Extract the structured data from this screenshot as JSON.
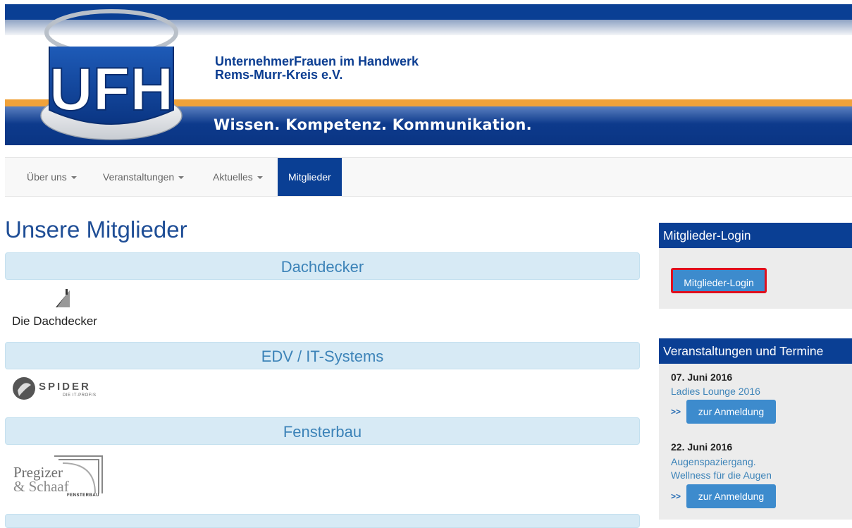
{
  "header": {
    "org_name": "UnternehmerFrauen im Handwerk\nRems-Murr-Kreis e.V.",
    "slogan": "Wissen. Kompetenz. Kommunikation.",
    "logo_text": "UFH"
  },
  "nav": {
    "items": [
      {
        "label": "Über uns",
        "dropdown": true
      },
      {
        "label": "Veranstaltungen",
        "dropdown": true
      },
      {
        "label": "Aktuelles",
        "dropdown": true
      },
      {
        "label": "Mitglieder",
        "dropdown": false,
        "active": true
      }
    ]
  },
  "main": {
    "title": "Unsere Mitglieder",
    "categories": [
      {
        "label": "Dachdecker",
        "logo_text": "Die Dachdecker"
      },
      {
        "label": "EDV / IT-Systems",
        "logo_text": "SPIDER",
        "logo_subtext": "DIE IT-PROFIS"
      },
      {
        "label": "Fensterbau",
        "logo_text_1": "Pregizer",
        "logo_text_2": "& Schaaf",
        "logo_subtext": "FENSTERBAU"
      }
    ]
  },
  "sidebar": {
    "login": {
      "heading": "Mitglieder-Login",
      "button_label": "Mitglieder-Login"
    },
    "events": {
      "heading": "Veranstaltungen und Termine",
      "arrows": ">>",
      "items": [
        {
          "date": "07. Juni 2016",
          "title": "Ladies Lounge 2016",
          "button_label": "zur Anmeldung"
        },
        {
          "date": "22. Juni 2016",
          "title": "Augenspaziergang.\nWellness für die Augen",
          "button_label": "zur Anmeldung"
        }
      ]
    }
  },
  "colors": {
    "brand_blue": "#0a3f94",
    "accent_orange": "#f0a23a",
    "button_blue": "#3d8bcd",
    "category_bg": "#d7eaf5",
    "highlight_red": "#e0101e"
  }
}
